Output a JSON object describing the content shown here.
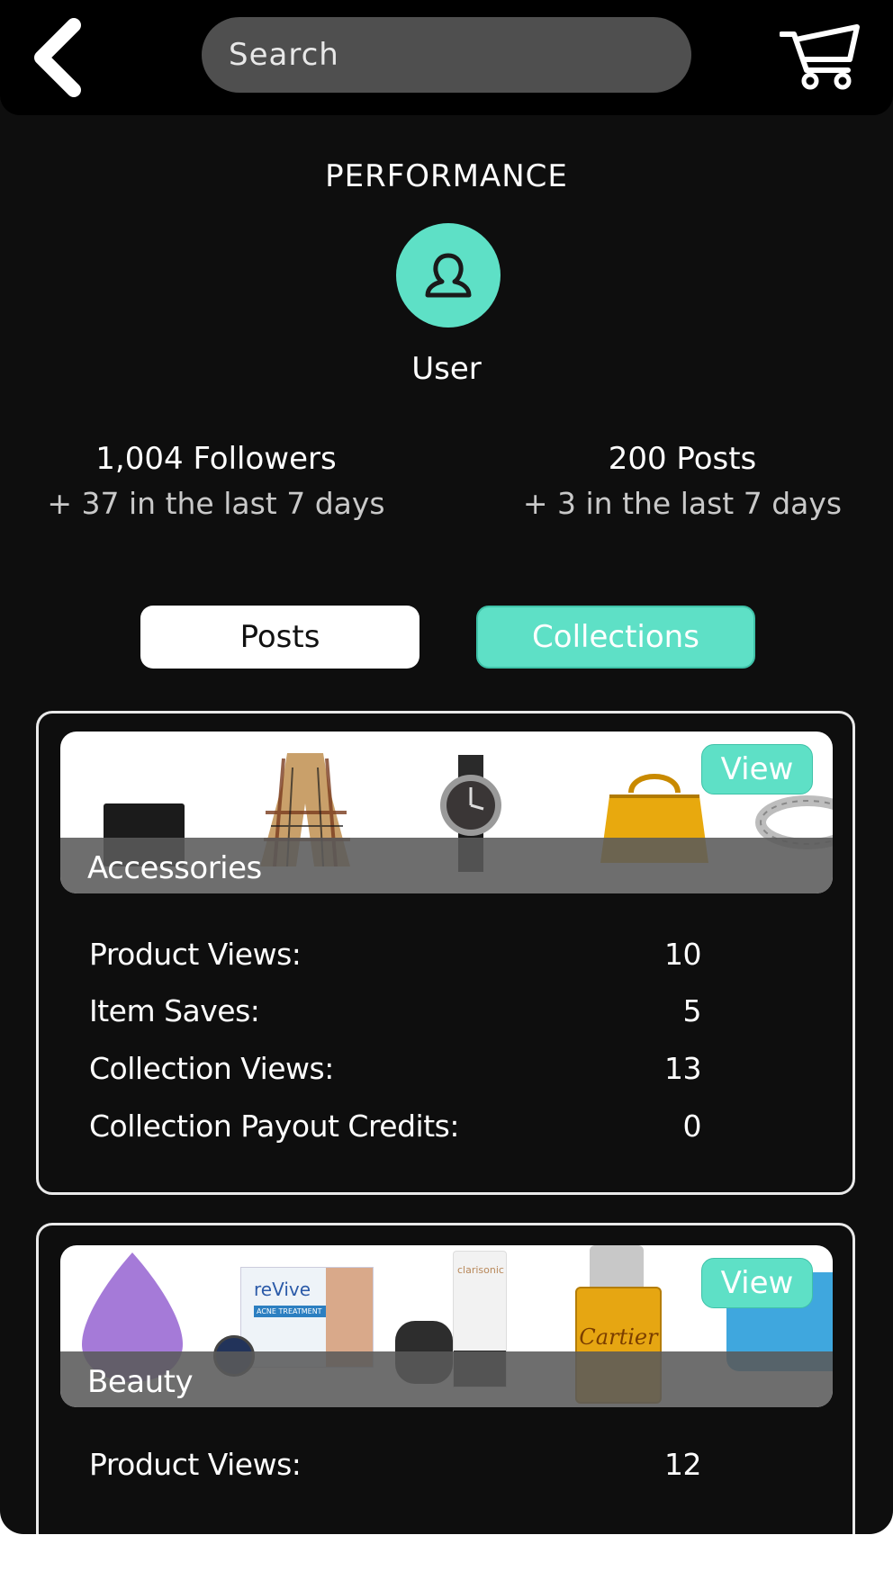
{
  "header": {
    "search_placeholder": "Search"
  },
  "page_title": "PERFORMANCE",
  "profile": {
    "name": "User"
  },
  "stats": {
    "followers": {
      "label": "1,004 Followers",
      "delta": "+ 37 in the last 7 days"
    },
    "posts": {
      "label": "200 Posts",
      "delta": "+ 3 in the last 7 days"
    }
  },
  "tabs": {
    "posts": "Posts",
    "collections": "Collections"
  },
  "colors": {
    "accent": "#5ee0c6",
    "background": "#0e0e0e",
    "search_bg": "#4f4f4f"
  },
  "collections": [
    {
      "name": "Accessories",
      "view_label": "View",
      "metrics": [
        {
          "label": "Product Views:",
          "value": "10"
        },
        {
          "label": "Item Saves:",
          "value": "5"
        },
        {
          "label": "Collection Views:",
          "value": "13"
        },
        {
          "label": "Collection Payout Credits:",
          "value": "0"
        }
      ]
    },
    {
      "name": "Beauty",
      "view_label": "View",
      "product_text": {
        "revive": "reVive",
        "acne": "ACNE TREATMENT",
        "clarisonic": "clarisonic",
        "cartier": "Cartier"
      },
      "metrics": [
        {
          "label": "Product Views:",
          "value": "12"
        }
      ]
    }
  ]
}
